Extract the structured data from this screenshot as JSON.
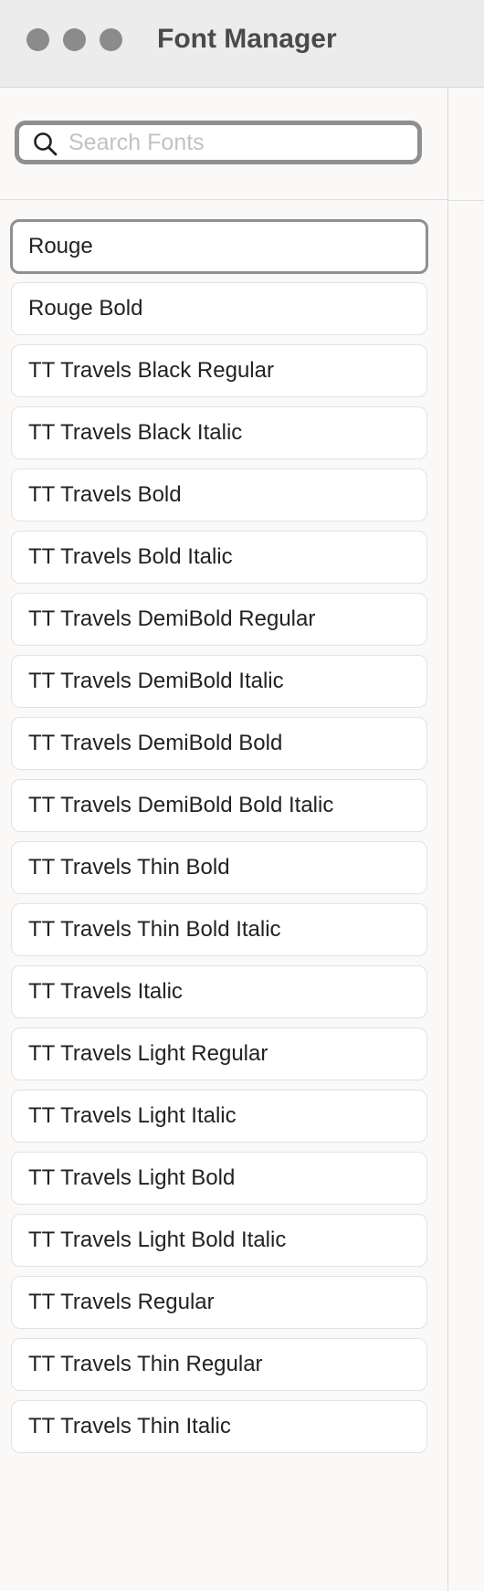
{
  "window": {
    "title": "Font Manager",
    "traffic_lights": [
      "close-button",
      "minimize-button",
      "zoom-button"
    ]
  },
  "search": {
    "placeholder": "Search Fonts",
    "value": "",
    "icon": "search-icon"
  },
  "font_list": {
    "selected": "Rouge",
    "items": [
      "Rouge",
      "Rouge Bold",
      "TT Travels Black Regular",
      "TT Travels Black Italic",
      "TT Travels Bold",
      "TT Travels Bold Italic",
      "TT Travels DemiBold Regular",
      "TT Travels DemiBold Italic",
      "TT Travels DemiBold Bold",
      "TT Travels DemiBold Bold Italic",
      "TT Travels Thin Bold",
      "TT Travels Thin Bold Italic",
      "TT Travels Italic",
      "TT Travels Light Regular",
      "TT Travels Light Italic",
      "TT Travels Light Bold",
      "TT Travels Light Bold Italic",
      "TT Travels Regular",
      "TT Travels Thin Regular",
      "TT Travels Thin Italic"
    ]
  },
  "colors": {
    "titlebar": "#ececec",
    "traffic_light": "#8b8b8b",
    "selected_border": "#8f8f8f",
    "background": "#faf9f8"
  }
}
